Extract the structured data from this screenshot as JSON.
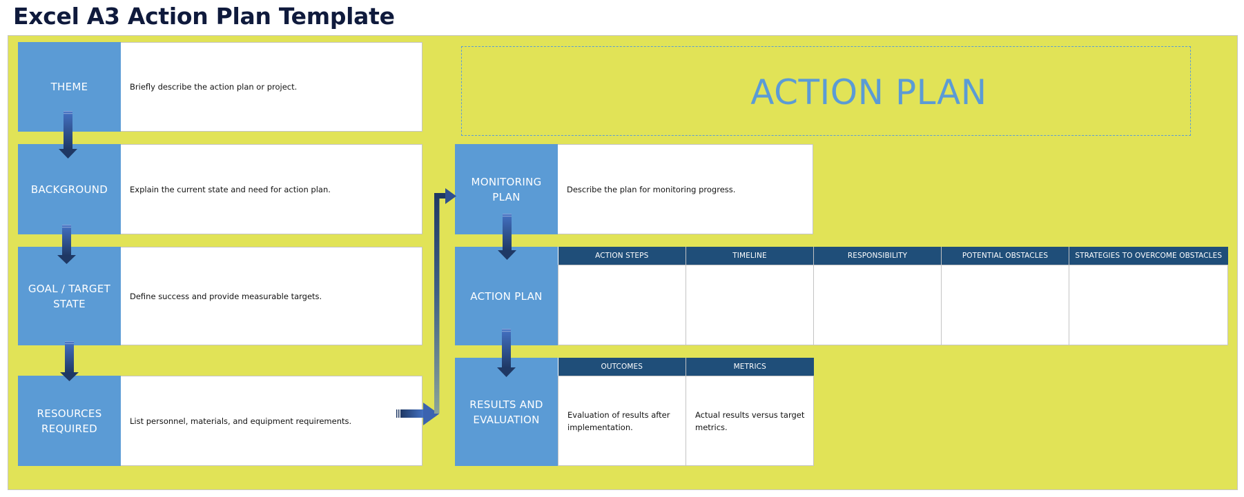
{
  "page": {
    "title": "Excel A3 Action Plan Template"
  },
  "hero": {
    "title": "ACTION PLAN"
  },
  "colors": {
    "panel_background": "#e1e357",
    "label_blue": "#5b9bd5",
    "header_navy": "#1f4e79",
    "title_navy": "#0f1a3c",
    "arrow_dark": "#1f3864",
    "arrow_light": "#4472c4"
  },
  "left_sections": [
    {
      "label": "THEME",
      "description": "Briefly describe the action plan or project."
    },
    {
      "label": "BACKGROUND",
      "description": "Explain the current state and need for action plan."
    },
    {
      "label": "GOAL / TARGET STATE",
      "description": "Define success and provide measurable targets."
    },
    {
      "label": "RESOURCES REQUIRED",
      "description": "List personnel, materials, and equipment requirements."
    }
  ],
  "monitoring": {
    "label": "MONITORING PLAN",
    "description": "Describe the plan for monitoring progress."
  },
  "action_plan": {
    "label": "ACTION PLAN",
    "columns": [
      "ACTION STEPS",
      "TIMELINE",
      "RESPONSIBILITY",
      "POTENTIAL OBSTACLES",
      "STRATEGIES TO OVERCOME OBSTACLES"
    ],
    "rows": [
      [
        "",
        "",
        "",
        "",
        ""
      ]
    ]
  },
  "results": {
    "label": "RESULTS AND EVALUATION",
    "columns": [
      "OUTCOMES",
      "METRICS"
    ],
    "rows": [
      [
        "Evaluation of results after implementation.",
        "Actual results versus target metrics."
      ]
    ]
  },
  "icons": {
    "flow_arrow_down": "down-arrow-icon",
    "flow_connector": "elbow-connector-arrow-icon",
    "flow_arrow_right": "right-arrow-icon"
  }
}
